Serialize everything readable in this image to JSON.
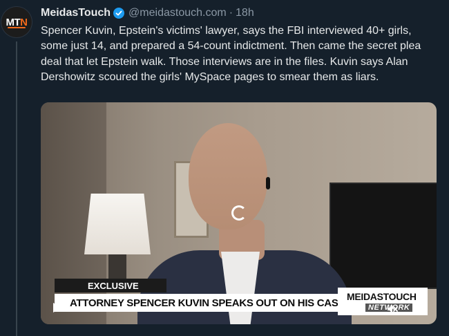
{
  "author": {
    "avatar_text_main": "MT",
    "avatar_text_accent": "N",
    "display_name": "MeidasTouch",
    "handle": "@meidastouch.com",
    "separator": "·",
    "timestamp": "18h",
    "verified": true
  },
  "tweet": {
    "text": "Spencer Kuvin, Epstein's victims' lawyer, says the FBI interviewed 40+ girls, some just 14, and prepared a 54-count indictment. Then came the secret plea deal that let Epstein walk. Those interviews are in the files. Kuvin says Alan Dershowitz scoured the girls' MySpace pages to smear them as liars."
  },
  "video": {
    "exclusive_label": "EXCLUSIVE",
    "lower_third": "ATTORNEY SPENCER KUVIN SPEAKS OUT ON HIS CASES AGAINST",
    "brand_name": "MEIDASTOUCH",
    "brand_sub": "NETWORK",
    "controls": [
      "play-icon",
      "mute-icon",
      "expand-icon"
    ]
  },
  "colors": {
    "background": "#15202b",
    "text": "#e7e9ea",
    "secondary": "#8b98a5",
    "verified": "#1d9bf0",
    "brand_accent": "#f26a1b"
  }
}
